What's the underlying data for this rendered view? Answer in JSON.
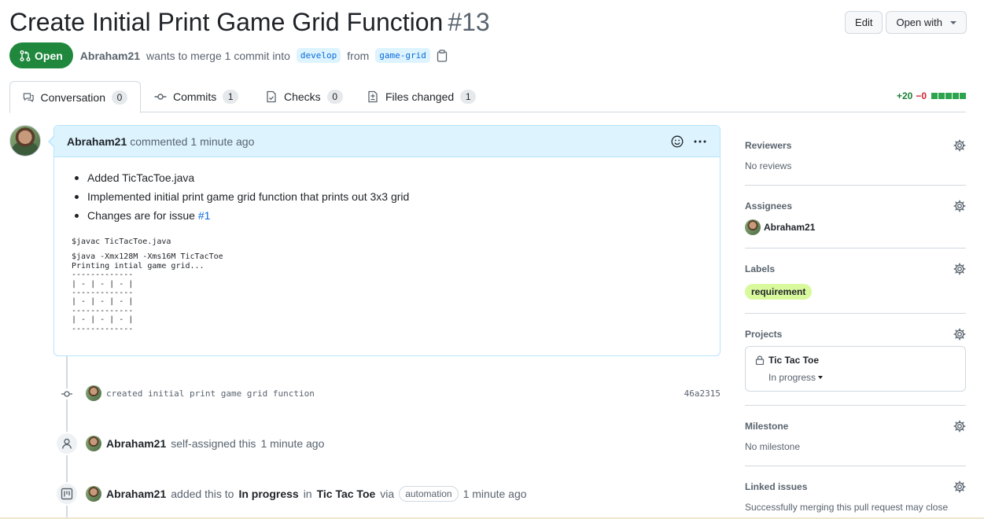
{
  "pr": {
    "title": "Create Initial Print Game Grid Function",
    "number": "#13",
    "state": "Open",
    "author": "Abraham21",
    "merge_text": "wants to merge 1 commit into",
    "base_branch": "develop",
    "from_text": "from",
    "head_branch": "game-grid"
  },
  "header_actions": {
    "edit_label": "Edit",
    "open_with_label": "Open with"
  },
  "tabs": [
    {
      "label": "Conversation",
      "count": "0",
      "icon": "comment-discussion-icon"
    },
    {
      "label": "Commits",
      "count": "1",
      "icon": "git-commit-icon"
    },
    {
      "label": "Checks",
      "count": "0",
      "icon": "checklist-icon"
    },
    {
      "label": "Files changed",
      "count": "1",
      "icon": "file-diff-icon"
    }
  ],
  "diffstat": {
    "additions": "+20",
    "deletions": "−0"
  },
  "comment": {
    "author": "Abraham21",
    "action": "commented",
    "time": "1 minute ago",
    "bullets": [
      "Added TicTacToe.java",
      "Implemented initial print game grid function that prints out 3x3 grid"
    ],
    "issue_prefix": "Changes are for issue",
    "issue_link": "#1",
    "code_line1": "$javac TicTacToe.java",
    "code_block": "$java -Xmx128M -Xms16M TicTacToe\nPrinting intial game grid...\n-------------\n| - | - | - |\n-------------\n| - | - | - |\n-------------\n| - | - | - |\n-------------"
  },
  "timeline": {
    "commit_message": "created initial print game grid function",
    "commit_sha": "46a2315",
    "assign_author": "Abraham21",
    "assign_text": "self-assigned this",
    "assign_time": "1 minute ago",
    "project_author": "Abraham21",
    "project_added": "added this to",
    "project_column": "In progress",
    "project_in": "in",
    "project_name": "Tic Tac Toe",
    "project_via": "via",
    "project_badge": "automation",
    "project_time": "1 minute ago"
  },
  "sidebar": {
    "reviewers": {
      "title": "Reviewers",
      "value": "No reviews"
    },
    "assignees": {
      "title": "Assignees",
      "value": "Abraham21"
    },
    "labels": {
      "title": "Labels",
      "value": "requirement",
      "color": "#d9f99d"
    },
    "projects": {
      "title": "Projects",
      "name": "Tic Tac Toe",
      "status": "In progress"
    },
    "milestone": {
      "title": "Milestone",
      "value": "No milestone"
    },
    "linked": {
      "title": "Linked issues",
      "value": "Successfully merging this pull request may close"
    }
  },
  "colors": {
    "open_green": "#1f883d",
    "link_blue": "#0969da",
    "comment_header_bg": "#ddf4ff"
  }
}
